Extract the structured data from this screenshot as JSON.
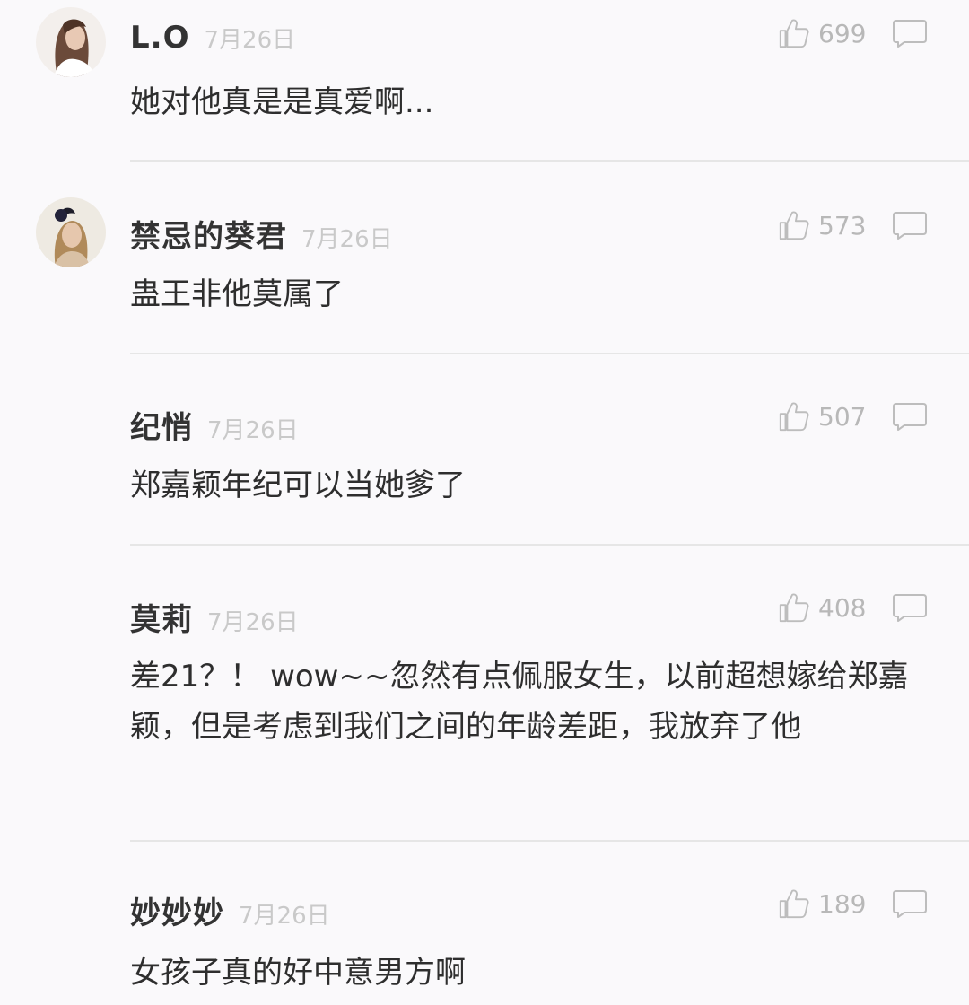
{
  "comments": [
    {
      "user": "L.O",
      "date": "7月26日",
      "likes": "699",
      "text": "她对他真是是真爱啊...",
      "avatar": "avatar-woman-long-hair",
      "has_avatar": true
    },
    {
      "user": "禁忌的葵君",
      "date": "7月26日",
      "likes": "573",
      "text": "蛊王非他莫属了",
      "avatar": "avatar-woman-fascinator",
      "has_avatar": true
    },
    {
      "user": "纪悄",
      "date": "7月26日",
      "likes": "507",
      "text": "郑嘉颖年纪可以当她爹了",
      "has_avatar": false
    },
    {
      "user": "莫莉",
      "date": "7月26日",
      "likes": "408",
      "text": "差21？！ wow~~忽然有点佩服女生，以前超想嫁给郑嘉颖，但是考虑到我们之间的年龄差距，我放弃了他",
      "has_avatar": false
    },
    {
      "user": "妙妙妙",
      "date": "7月26日",
      "likes": "189",
      "text": "女孩子真的好中意男方啊",
      "has_avatar": false
    }
  ],
  "icons": {
    "like": "thumbs-up-icon",
    "reply": "comment-bubble-icon"
  },
  "colors": {
    "name": "#333333",
    "date": "#c9c9c9",
    "count": "#b8b8b8",
    "text": "#2e2e2e",
    "divider": "#e6e6e6"
  }
}
